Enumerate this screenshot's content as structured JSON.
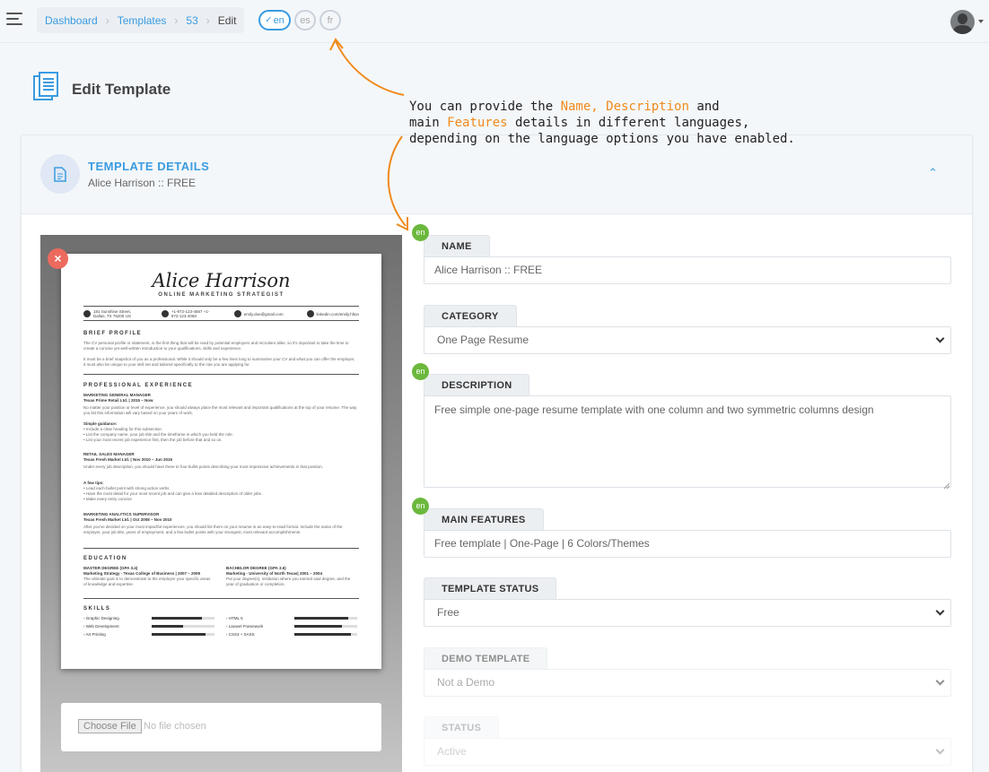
{
  "topbar": {
    "breadcrumb": [
      "Dashboard",
      "Templates",
      "53",
      "Edit"
    ],
    "languages": [
      {
        "code": "en",
        "active": true
      },
      {
        "code": "es",
        "active": false
      },
      {
        "code": "fr",
        "active": false
      }
    ],
    "menu_icon": "hamburger-icon",
    "user_icon": "user-avatar-icon"
  },
  "page": {
    "title": "Edit Template",
    "icon": "documents-icon"
  },
  "annotation": {
    "line1_pre": "You can provide the ",
    "name_hl": "Name,",
    "desc_hl": "Description",
    "line1_post": " and",
    "line2_pre": "main ",
    "features_hl": "Features",
    "line2_post": " details in different languages,",
    "line3": "depending on the language options you have enabled."
  },
  "card": {
    "header_title": "TEMPLATE DETAILS",
    "header_subtitle": "Alice Harrison :: FREE",
    "header_icon": "document-icon"
  },
  "preview": {
    "remove_label": "×",
    "file_button": "Choose File",
    "file_status": "No file chosen",
    "resume": {
      "name": "Alice Harrison",
      "role": "ONLINE MARKETING STRATEGIST",
      "address": "181 Sunshine Street, Dallas, TX 75205 US",
      "phone": "+1-972-123-4567 +1-972-123-4068",
      "email": "emily.doe@gmail.com",
      "web": "linkedin.com/emily.hlton",
      "h_profile": "BRIEF PROFILE",
      "profile1": "The CV personal profile or statement, is the first thing that will be read by potential employers and recruiters alike, so it's important to take the time to create a concise yet well-written introduction to your qualifications, skills and experience.",
      "profile2": "It must be a brief snapshot of you as a professional. While it should only be a few lines long to summarise your CV and what you can offer the employer, it must also be unique to your skill set and tailored specifically to the role you are applying for.",
      "h_experience": "PROFESSIONAL EXPERIENCE",
      "job1_title": "MARKETING GENERAL MANAGER",
      "job1_company": "Texas Prime Retail Ltd. | 2015 – Now",
      "job1_text": "No matter your position or level of experience, you should always place the most relevant and important qualifications at the top of your resume. The way you list this information will vary based on your years of work.",
      "job1_guidance": "Simple guidance:",
      "job1_bullets": "• Include a clear heading for this subsection\n• List the company name, your job title and the timeframe in which you held the role.\n• List your most recent job experience first, then the job before that and so on.",
      "job2_title": "RETAIL SALES MANAGER",
      "job2_company": "Texas Fresh Market Ltd. | Nov 2010 – Jun 2015",
      "job2_text": "Under every job description, you should have three to four bullet points describing your most impressive achievements in that position.",
      "job2_tips": "A few tips:",
      "job2_bullets": "• Lead each bullet point with strong action verbs\n• Have the most detail for your most recent job and can give a less detailed description of older jobs.\n• Make every entry concise",
      "job3_title": "MARKETING ANALYTICS SUPERVISOR",
      "job3_company": "Texas Fresh Market Ltd. | Oct 2008 – Nov 2010",
      "job3_text": "After you've decided on your most impactful experiences, you should list them on your resume in an easy-to-read format. Include the name of the employer, your job title, years of employment, and a few bullet points with your strongest, most relevant accomplishments.",
      "h_education": "EDUCATION",
      "edu1_title": "MASTER DEGREE (GPA 3.4)",
      "edu1_school": "Marketing Strategy - Texas College of Business | 2007 – 2009",
      "edu1_text": "The ultimate goal is to demonstrate to the employer your specific areas of knowledge and expertise.",
      "edu2_title": "BACHELOR DEGREE (GPA 3.6)",
      "edu2_school": "Marketing - University of North Texas| 2001 – 2004",
      "edu2_text": "Put your degree(s), institution where you earned said degree, and the year of graduation or completion.",
      "h_skills": "SKILLS",
      "skills": [
        {
          "name": "› Graphic Designing",
          "level": 0.8
        },
        {
          "name": "› Web Development",
          "level": 0.5
        },
        {
          "name": "› Art Printing",
          "level": 0.85
        },
        {
          "name": "› HTML 5",
          "level": 0.85
        },
        {
          "name": "› Laravel Framework",
          "level": 0.75
        },
        {
          "name": "› CSS3 + SASS",
          "level": 0.9
        }
      ]
    }
  },
  "form": {
    "name": {
      "label": "NAME",
      "lang": "en",
      "value": "Alice Harrison :: FREE"
    },
    "category": {
      "label": "CATEGORY",
      "value": "One Page Resume"
    },
    "description": {
      "label": "DESCRIPTION",
      "lang": "en",
      "value": "Free simple one-page resume template with one column and two symmetric columns design"
    },
    "features": {
      "label": "MAIN FEATURES",
      "lang": "en",
      "value": "Free template | One-Page | 6 Colors/Themes"
    },
    "template_status": {
      "label": "TEMPLATE STATUS",
      "value": "Free"
    },
    "demo_template": {
      "label": "DEMO TEMPLATE",
      "value": "Not a Demo"
    },
    "status": {
      "label": "STATUS",
      "value": "Active"
    }
  },
  "colors": {
    "accent": "#3a9be0",
    "highlight": "#f08a1c",
    "lang_badge": "#6bb83d",
    "remove": "#ec6a5e"
  }
}
